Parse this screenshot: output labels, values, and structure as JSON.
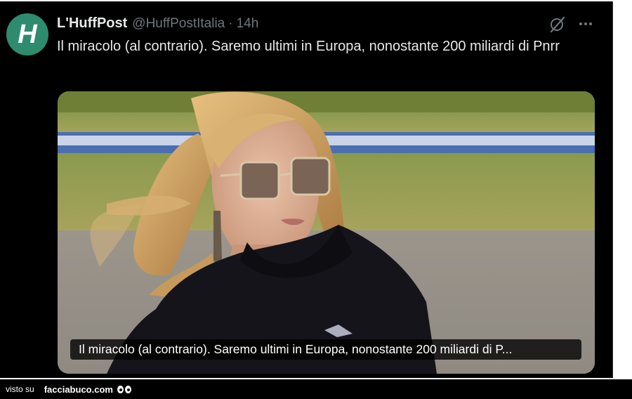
{
  "tweet": {
    "account_name": "L'HuffPost",
    "handle": "@HuffPostItalia",
    "separator": "·",
    "time": "14h",
    "text": "Il miracolo (al contrario). Saremo ultimi in Europa, nonostante 200 miliardi di Pnrr",
    "media_caption": "Il miracolo (al contrario). Saremo ultimi in Europa, nonostante 200 miliardi di P...",
    "icons": {
      "avatar_logo": "huffpost-h-logo",
      "grok": "grok-slash-icon",
      "more": "more-horizontal-icon"
    },
    "colors": {
      "background": "#000000",
      "primary_text": "#e7e9ea",
      "secondary_text": "#71767b",
      "avatar_green": "#2e8b6e"
    }
  },
  "footer": {
    "prefix": "visto su",
    "site": "facciabuco.com",
    "logo_icon": "eyes-icon"
  }
}
